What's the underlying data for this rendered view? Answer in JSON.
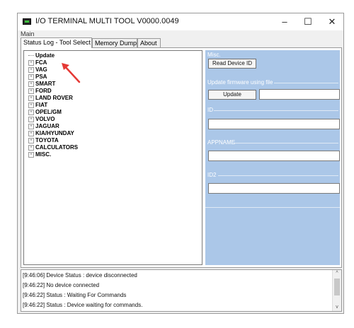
{
  "window": {
    "title": "I/O TERMINAL MULTI TOOL V0000.0049",
    "minimize": "–",
    "maximize": "☐",
    "close": "✕"
  },
  "menu": {
    "main_label": "Main"
  },
  "tabs": [
    {
      "label": "Status Log - Tool Select"
    },
    {
      "label": "Memory Dump"
    },
    {
      "label": "About"
    }
  ],
  "tree": {
    "items": [
      {
        "label": "Update",
        "expander": ""
      },
      {
        "label": "FCA",
        "expander": "+"
      },
      {
        "label": "VAG",
        "expander": "+"
      },
      {
        "label": "PSA",
        "expander": "+"
      },
      {
        "label": "SMART",
        "expander": "+"
      },
      {
        "label": "FORD",
        "expander": "+"
      },
      {
        "label": "LAND ROVER",
        "expander": "+"
      },
      {
        "label": "FIAT",
        "expander": "+"
      },
      {
        "label": "OPEL/GM",
        "expander": "+"
      },
      {
        "label": "VOLVO",
        "expander": "+"
      },
      {
        "label": "JAGUAR",
        "expander": "+"
      },
      {
        "label": "KIA/HYUNDAY",
        "expander": "+"
      },
      {
        "label": "TOYOTA",
        "expander": "+"
      },
      {
        "label": "CALCULATORS",
        "expander": "+"
      },
      {
        "label": "MISC.",
        "expander": "+"
      }
    ]
  },
  "panel": {
    "misc_label": "Misc.",
    "read_device_id_button": "Read Device ID",
    "update_firmware_label": "Update firmware  using file",
    "update_button": "Update",
    "firmware_file_value": "",
    "id_label": "ID",
    "id_value": "",
    "appname_label": "APPNAME",
    "appname_value": "",
    "id2_label": "ID2",
    "id2_value": ""
  },
  "log": {
    "lines": [
      "[9:46:06] Device Status : device disconnected",
      "[9:46:22] No device connected",
      "[9:46:22] Status : Waiting For Commands",
      "[9:46:22] Status : Device waiting for commands."
    ],
    "scroll_up": "^",
    "scroll_down": "v"
  },
  "colors": {
    "panel_bg": "#abc7e8",
    "arrow": "#e53935",
    "title_bar": "#ffffff"
  },
  "icons": {
    "app": "terminal-app-icon",
    "annotation": "red-arrow-icon"
  }
}
